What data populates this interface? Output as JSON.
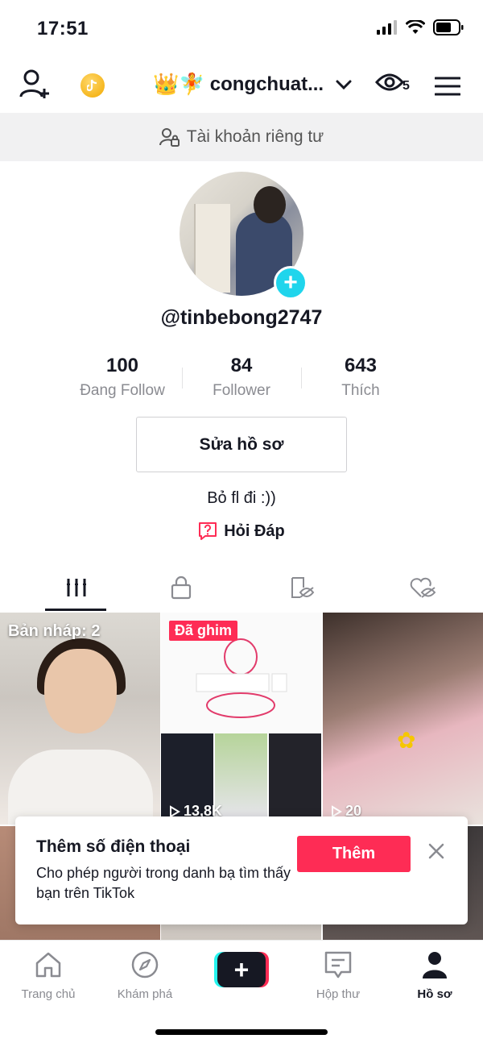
{
  "status": {
    "time": "17:51"
  },
  "header": {
    "account_emoji": "👑🧚",
    "account_name": "congchuat...",
    "views_count": "5"
  },
  "banner": {
    "text": "Tài khoản riêng tư"
  },
  "profile": {
    "username": "@tinbebong2747",
    "stats": [
      {
        "value": "100",
        "label": "Đang Follow"
      },
      {
        "value": "84",
        "label": "Follower"
      },
      {
        "value": "643",
        "label": "Thích"
      }
    ],
    "edit_button": "Sửa hồ sơ",
    "bio": "Bỏ fl đi :))",
    "qa_label": "Hỏi Đáp"
  },
  "grid": {
    "drafts_label": "Bản nháp: 2",
    "pinned_label": "Đã ghim",
    "items": [
      {
        "views": ""
      },
      {
        "views": "13,8K"
      },
      {
        "views": "20"
      }
    ]
  },
  "popup": {
    "title": "Thêm số điện thoại",
    "description": "Cho phép người trong danh bạ tìm thấy bạn trên TikTok",
    "button": "Thêm"
  },
  "bottom_nav": [
    {
      "label": "Trang chủ",
      "icon": "home-icon"
    },
    {
      "label": "Khám phá",
      "icon": "compass-icon"
    },
    {
      "label": "",
      "icon": "create-plus-icon"
    },
    {
      "label": "Hộp thư",
      "icon": "inbox-icon"
    },
    {
      "label": "Hồ sơ",
      "icon": "profile-icon"
    }
  ],
  "colors": {
    "accent": "#fe2c55",
    "cyan": "#25f4ee",
    "text": "#161823",
    "muted": "#8a8b91"
  }
}
